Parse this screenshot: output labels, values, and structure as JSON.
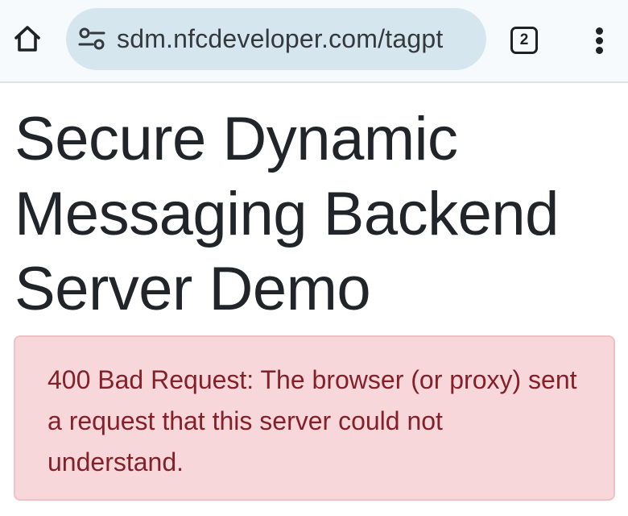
{
  "browser": {
    "url": "sdm.nfcdeveloper.com/tagpt",
    "tab_count": "2",
    "icons": {
      "home": "home-icon",
      "site_info": "site-settings-icon",
      "tabs": "tab-switcher-icon",
      "menu": "more-vert-icon"
    }
  },
  "page": {
    "title": "Secure Dynamic Messaging Backend Server Demo",
    "alert_message": "400 Bad Request: The browser (or proxy) sent a request that this server could not understand."
  },
  "colors": {
    "toolbar_bg": "#f7fafc",
    "urlbar_bg": "#d6e6ef",
    "title_text": "#212529",
    "alert_bg": "#f8d7da",
    "alert_border": "#f1c0c5",
    "alert_text": "#842029"
  }
}
